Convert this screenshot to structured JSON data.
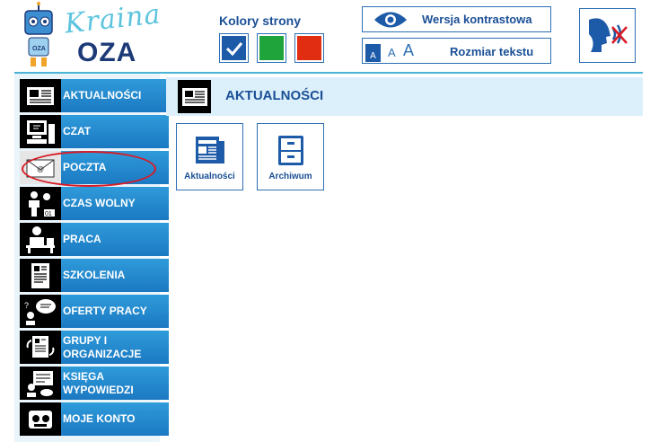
{
  "logo": {
    "line1": "Kraina",
    "line2": "OZA"
  },
  "header": {
    "colors_label": "Kolory strony",
    "color_options": [
      {
        "name": "blue",
        "color": "#1d5aa8",
        "selected": true
      },
      {
        "name": "green",
        "color": "#1ea43a",
        "selected": false
      },
      {
        "name": "red",
        "color": "#e12d12",
        "selected": false
      }
    ],
    "contrast_label": "Wersja kontrastowa",
    "textsize_label": "Rozmiar tekstu",
    "textsize_letters": [
      "A",
      "A",
      "A"
    ],
    "speech_icon": "speech-off-icon"
  },
  "sidebar": {
    "items": [
      {
        "label": "AKTUALNOŚCI",
        "icon": "newspaper-icon"
      },
      {
        "label": "CZAT",
        "icon": "computer-chat-icon"
      },
      {
        "label": "POCZTA",
        "icon": "envelope-icon"
      },
      {
        "label": "CZAS WOLNY",
        "icon": "leisure-icon"
      },
      {
        "label": "PRACA",
        "icon": "work-desk-icon"
      },
      {
        "label": "SZKOLENIA",
        "icon": "training-doc-icon"
      },
      {
        "label": "OFERTY PRACY",
        "icon": "job-offer-icon"
      },
      {
        "label": "GRUPY I ORGANIZACJE",
        "icon": "groups-icon"
      },
      {
        "label": "KSIĘGA WYPOWIEDZI",
        "icon": "guestbook-icon"
      },
      {
        "label": "MOJE KONTO",
        "icon": "account-icon"
      }
    ]
  },
  "main": {
    "title": "AKTUALNOŚCI",
    "tiles": [
      {
        "label": "Aktualności",
        "icon": "news-icon"
      },
      {
        "label": "Archiwum",
        "icon": "archive-cabinet-icon"
      }
    ]
  },
  "colors": {
    "accent": "#1a4f96",
    "nav_blue": "#2f9bda",
    "highlight": "#d91a24"
  }
}
